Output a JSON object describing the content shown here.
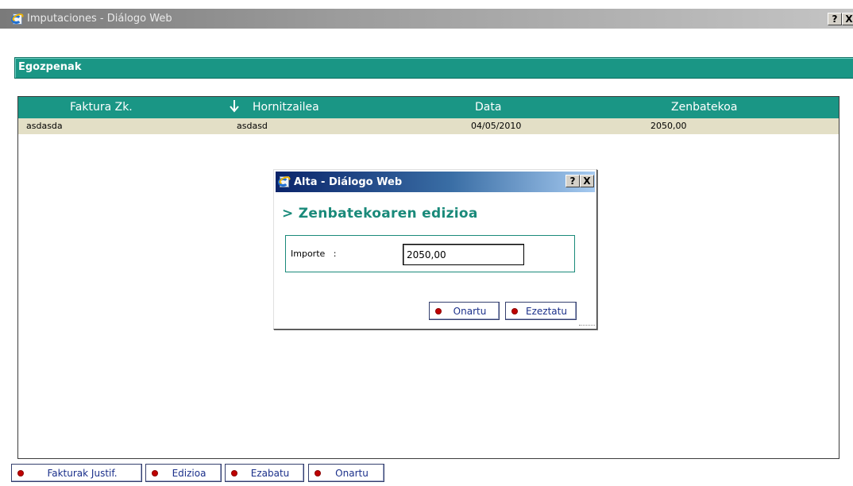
{
  "window": {
    "title": "Imputaciones - Diálogo Web",
    "help_label": "?",
    "close_label": "X"
  },
  "section": {
    "title": "Egozpenak"
  },
  "grid": {
    "columns": [
      "Faktura Zk.",
      "Hornitzailea",
      "Data",
      "Zenbatekoa"
    ],
    "rows": [
      [
        "asdasda",
        "asdasd",
        "04/05/2010",
        "2050,00"
      ]
    ]
  },
  "dialog": {
    "title": "Alta - Diálogo Web",
    "help_label": "?",
    "close_label": "X",
    "heading": "> Zenbatekoaren edizioa",
    "field_label": "Importe   :",
    "field_value": "2050,00",
    "ok_label": "Onartu",
    "cancel_label": "Ezeztatu"
  },
  "toolbar": {
    "justify_label": "Fakturak Justif.",
    "edit_label": "Edizioa",
    "delete_label": "Ezabatu",
    "accept_label": "Onartu"
  },
  "colors": {
    "accent": "#1a9685",
    "row_highlight": "#e3dfc6",
    "dialog_title": "#0a246a",
    "button_dot": "#c00000"
  }
}
